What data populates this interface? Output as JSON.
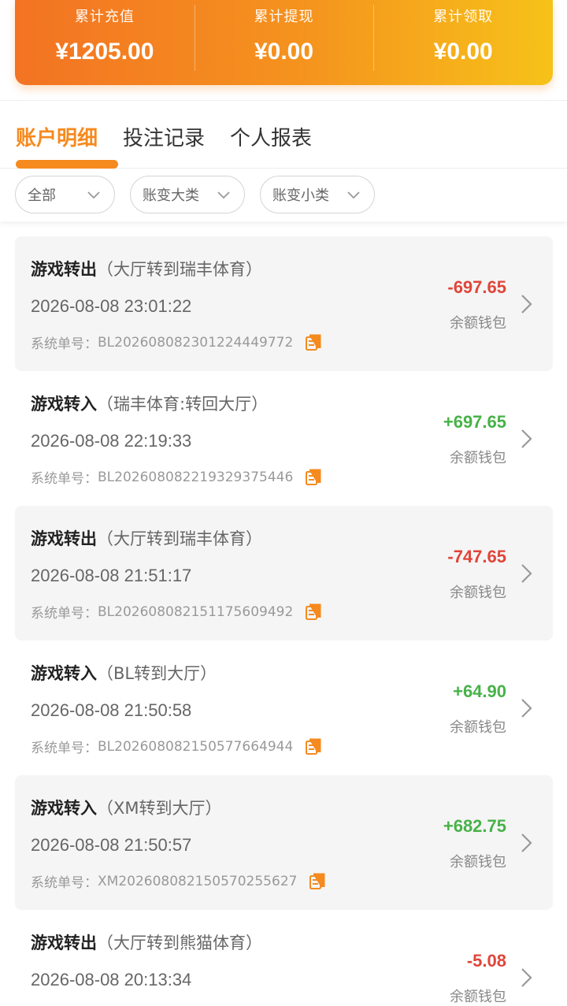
{
  "summary": [
    {
      "label": "累计充值",
      "value": "¥1205.00"
    },
    {
      "label": "累计提现",
      "value": "¥0.00"
    },
    {
      "label": "累计领取",
      "value": "¥0.00"
    }
  ],
  "tabs": [
    {
      "label": "账户明细",
      "active": true
    },
    {
      "label": "投注记录",
      "active": false
    },
    {
      "label": "个人报表",
      "active": false
    }
  ],
  "filters": [
    {
      "label": "全部",
      "icon": "chevron-down-icon"
    },
    {
      "label": "账变大类",
      "icon": "chevron-down-icon"
    },
    {
      "label": "账变小类",
      "icon": "chevron-down-icon"
    }
  ],
  "records": [
    {
      "type": "游戏转出",
      "desc": "（大厅转到瑞丰体育）",
      "time": "2026-08-08 23:01:22",
      "order_label": "系统单号：",
      "order": "BL202608082301224449772",
      "amount": "-697.65",
      "sign": "neg",
      "wallet": "余额钱包"
    },
    {
      "type": "游戏转入",
      "desc": "（瑞丰体育:转回大厅）",
      "time": "2026-08-08 22:19:33",
      "order_label": "系统单号：",
      "order": "BL202608082219329375446",
      "amount": "+697.65",
      "sign": "pos",
      "wallet": "余额钱包"
    },
    {
      "type": "游戏转出",
      "desc": "（大厅转到瑞丰体育）",
      "time": "2026-08-08 21:51:17",
      "order_label": "系统单号：",
      "order": "BL202608082151175609492",
      "amount": "-747.65",
      "sign": "neg",
      "wallet": "余额钱包"
    },
    {
      "type": "游戏转入",
      "desc": "（BL转到大厅）",
      "time": "2026-08-08 21:50:58",
      "order_label": "系统单号：",
      "order": "BL202608082150577664944",
      "amount": "+64.90",
      "sign": "pos",
      "wallet": "余额钱包"
    },
    {
      "type": "游戏转入",
      "desc": "（XM转到大厅）",
      "time": "2026-08-08 21:50:57",
      "order_label": "系统单号：",
      "order": "XM202608082150570255627",
      "amount": "+682.75",
      "sign": "pos",
      "wallet": "余额钱包"
    },
    {
      "type": "游戏转出",
      "desc": "（大厅转到熊猫体育）",
      "time": "2026-08-08 20:13:34",
      "order_label": "",
      "order": "",
      "amount": "-5.08",
      "sign": "neg",
      "wallet": "余额钱包"
    }
  ],
  "colors": {
    "accent": "#f58a1f",
    "negative": "#e0453a",
    "positive": "#47b248",
    "gradient_start": "#f37323",
    "gradient_end": "#f6c219"
  }
}
